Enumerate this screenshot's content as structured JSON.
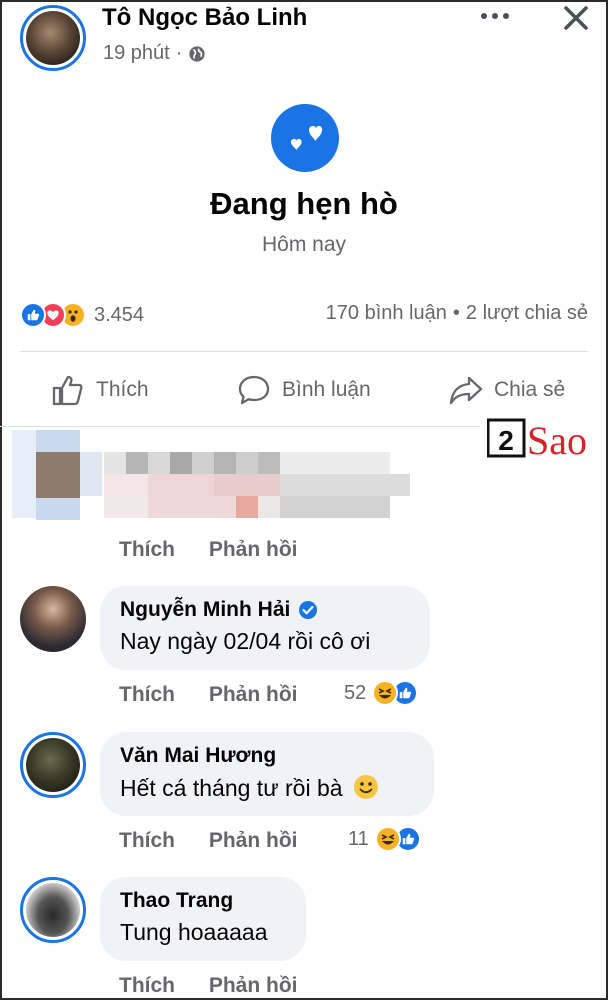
{
  "post": {
    "author": "Tô Ngọc Bảo Linh",
    "time": "19 phút",
    "dot": "·",
    "privacy_icon": "globe-icon",
    "more_icon": "more-icon",
    "close_icon": "close-icon"
  },
  "life_event": {
    "icon": "hearts-icon",
    "title": "Đang hẹn hò",
    "date": "Hôm nay",
    "accent_color": "#1b74e4"
  },
  "stats": {
    "reaction_icons": [
      "like-icon",
      "love-icon",
      "wow-icon"
    ],
    "reaction_count": "3.454",
    "comments": "170 bình luận",
    "separator": "•",
    "shares": "2 lượt chia sẻ"
  },
  "actions": {
    "like": "Thích",
    "comment": "Bình luận",
    "share": "Chia sẻ"
  },
  "watermark": {
    "number": "2",
    "word": "Sao"
  },
  "comments": [
    {
      "name": "",
      "text": "",
      "blurred": true,
      "like_label": "Thích",
      "reply_label": "Phản hồi"
    },
    {
      "name": "Nguyễn Minh Hải",
      "verified": true,
      "text": "Nay ngày 02/04 rồi cô ơi",
      "like_label": "Thích",
      "reply_label": "Phản hồi",
      "reaction_count": "52",
      "reactions": [
        "haha-icon",
        "like-icon"
      ]
    },
    {
      "name": "Văn Mai Hương",
      "text": "Hết cá tháng tư rồi bà",
      "emoji": "smile-emoji",
      "like_label": "Thích",
      "reply_label": "Phản hồi",
      "reaction_count": "11",
      "reactions": [
        "haha-icon",
        "like-icon"
      ]
    },
    {
      "name": "Thao Trang",
      "text": "Tung hoaaaaa",
      "like_label": "Thích",
      "reply_label": "Phản hồi"
    }
  ]
}
